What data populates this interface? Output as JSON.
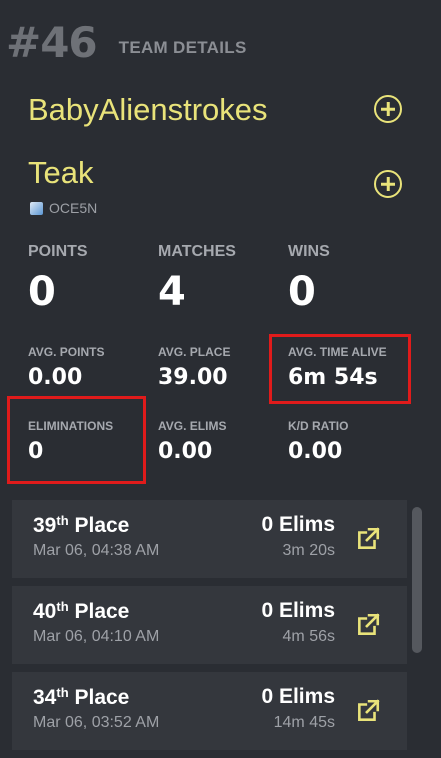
{
  "header": {
    "rank": "#46",
    "title": "TEAM DETAILS"
  },
  "players": [
    {
      "name": "BabyAlienstrokes"
    },
    {
      "name": "Teak",
      "platform": "OCE5N"
    }
  ],
  "stats_main": [
    {
      "label": "POINTS",
      "value": "0"
    },
    {
      "label": "MATCHES",
      "value": "4"
    },
    {
      "label": "WINS",
      "value": "0"
    }
  ],
  "stats_row1": [
    {
      "label": "AVG. POINTS",
      "value": "0.00"
    },
    {
      "label": "AVG. PLACE",
      "value": "39.00"
    },
    {
      "label": "AVG. TIME ALIVE",
      "value": "6m 54s"
    }
  ],
  "stats_row2": [
    {
      "label": "ELIMINATIONS",
      "value": "0"
    },
    {
      "label": "AVG. ELIMS",
      "value": "0.00"
    },
    {
      "label": "K/D RATIO",
      "value": "0.00"
    }
  ],
  "matches": [
    {
      "place_num": "39",
      "place_suffix": "th",
      "place_word": " Place",
      "date": "Mar 06, 04:38 AM",
      "elims": "0 Elims",
      "time": "3m 20s"
    },
    {
      "place_num": "40",
      "place_suffix": "th",
      "place_word": " Place",
      "date": "Mar 06, 04:10 AM",
      "elims": "0 Elims",
      "time": "4m 56s"
    },
    {
      "place_num": "34",
      "place_suffix": "th",
      "place_word": " Place",
      "date": "Mar 06, 03:52 AM",
      "elims": "0 Elims",
      "time": "14m 45s"
    }
  ],
  "colors": {
    "accent": "#e9e37a",
    "highlight": "#e01b1b",
    "background": "#2a2d33",
    "card": "#34373d"
  },
  "icons": {
    "add": "plus-circle-icon",
    "link": "external-link-icon",
    "platform": "platform-icon"
  }
}
